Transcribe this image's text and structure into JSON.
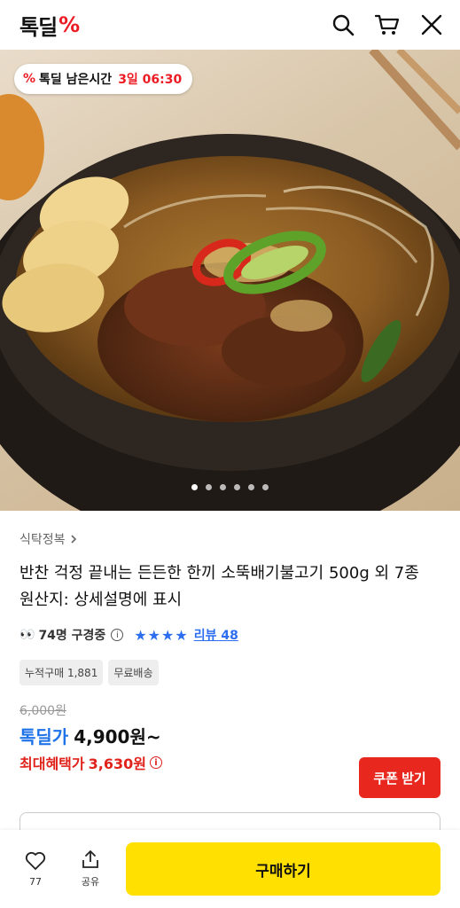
{
  "header": {
    "logo_text": "톡딜",
    "logo_mark": "%",
    "icons": [
      "search-icon",
      "cart-icon",
      "close-icon"
    ]
  },
  "hero": {
    "timer_mark": "%",
    "timer_label": "톡딜 남은시간",
    "timer_value": "3일 06:30",
    "slide_count": 6,
    "active_slide": 1
  },
  "product": {
    "breadcrumb": "식탁정복",
    "title": "반찬 걱정 끝내는 든든한 한끼 소뚝배기불고기 500g 외 7종",
    "origin": "원산지: 상세설명에 표시",
    "viewers": "74명 구경중",
    "stars": "★★★★",
    "review_link": "리뷰 48",
    "tags": [
      "누적구매 1,881",
      "무료배송"
    ],
    "original_price": "6,000원",
    "price_label": "톡딜가",
    "price_value": "4,900원~",
    "benefit_label": "최대혜택가",
    "benefit_value": "3,630원",
    "coupon_button": "쿠폰 받기"
  },
  "bottom_bar": {
    "like_count": "77",
    "share_label": "공유",
    "buy_button": "구매하기"
  },
  "colors": {
    "brand_red": "#ec1c24",
    "accent_blue": "#1f73e8",
    "buy_yellow": "#ffe000"
  }
}
